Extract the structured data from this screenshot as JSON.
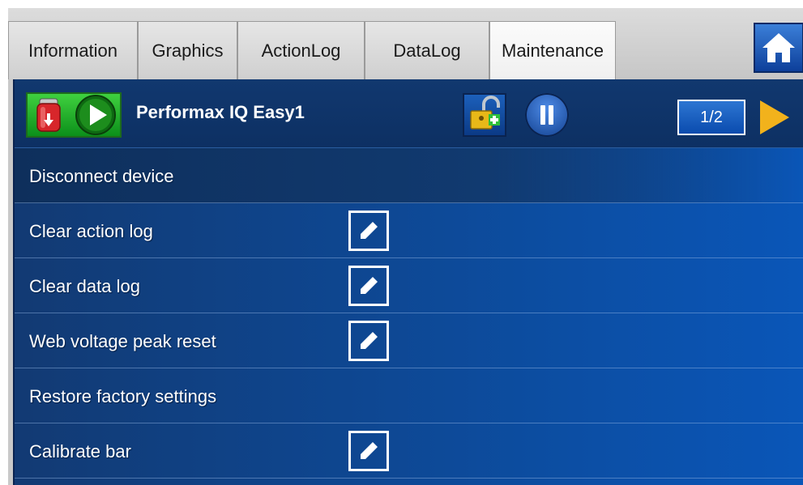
{
  "tabs": [
    {
      "label": "Information"
    },
    {
      "label": "Graphics"
    },
    {
      "label": "ActionLog"
    },
    {
      "label": "DataLog"
    },
    {
      "label": "Maintenance",
      "active": true
    }
  ],
  "header": {
    "device_name": "Performax IQ Easy1",
    "page_indicator": "1/2"
  },
  "maintenance_items": [
    {
      "label": "Disconnect device",
      "editable": false
    },
    {
      "label": "Clear action log",
      "editable": true
    },
    {
      "label": "Clear data log",
      "editable": true
    },
    {
      "label": "Web voltage peak reset",
      "editable": true
    },
    {
      "label": "Restore factory settings",
      "editable": false
    },
    {
      "label": "Calibrate bar",
      "editable": true
    }
  ],
  "icons": {
    "home": "home-icon",
    "device_status": "battery-icon",
    "run": "play-icon",
    "lock": "unlock-icon",
    "pause": "pause-icon",
    "next": "arrow-right-icon",
    "edit": "pencil-icon"
  },
  "colors": {
    "panel_blue": "#0d4a99",
    "status_green": "#17a82a",
    "next_arrow": "#f2b21c"
  }
}
